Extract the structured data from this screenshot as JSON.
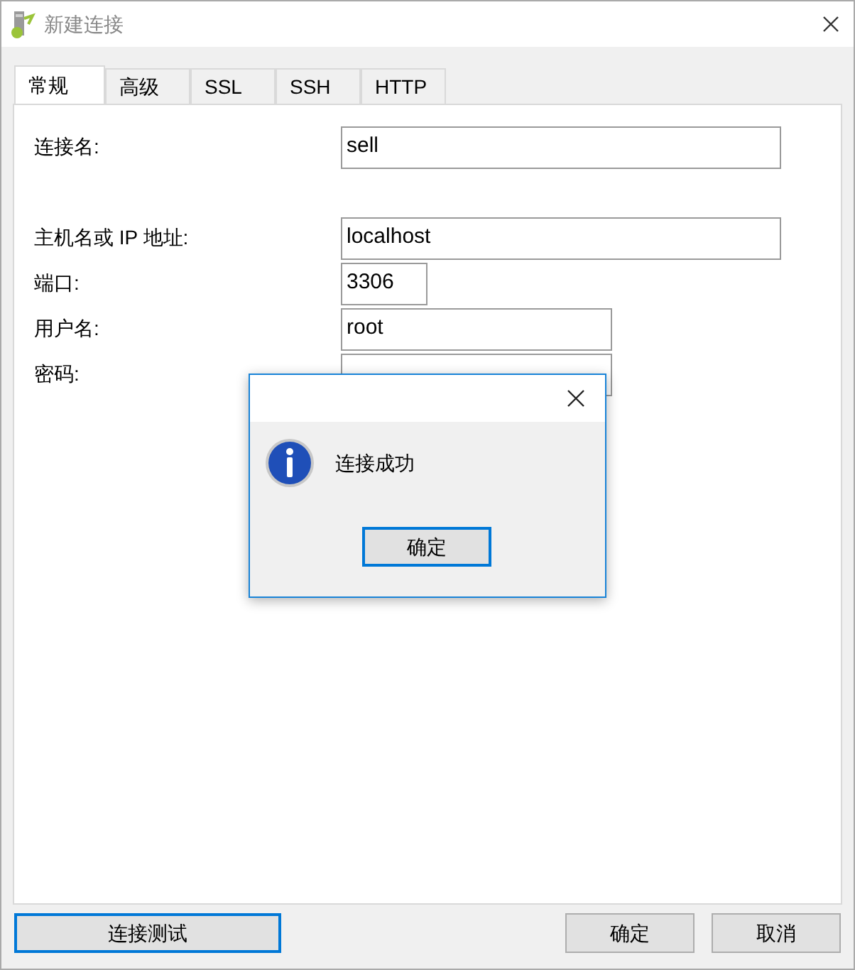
{
  "window": {
    "title": "新建连接"
  },
  "tabs": [
    {
      "label": "常规",
      "selected": true
    },
    {
      "label": "高级",
      "selected": false
    },
    {
      "label": "SSL",
      "selected": false
    },
    {
      "label": "SSH",
      "selected": false
    },
    {
      "label": "HTTP",
      "selected": false
    }
  ],
  "fields": [
    {
      "label": "连接名:",
      "value": "sell"
    },
    {
      "label": "主机名或 IP 地址:",
      "value": "localhost"
    },
    {
      "label": "端口:",
      "value": "3306"
    },
    {
      "label": "用户名:",
      "value": "root"
    },
    {
      "label": "密码:"
    }
  ],
  "dialog": {
    "message": "连接成功",
    "button": "确定"
  },
  "buttons": [
    {
      "label": "连接测试",
      "focused": true
    },
    {
      "label": "确定",
      "focused": false
    },
    {
      "label": "取消",
      "focused": false
    }
  ]
}
